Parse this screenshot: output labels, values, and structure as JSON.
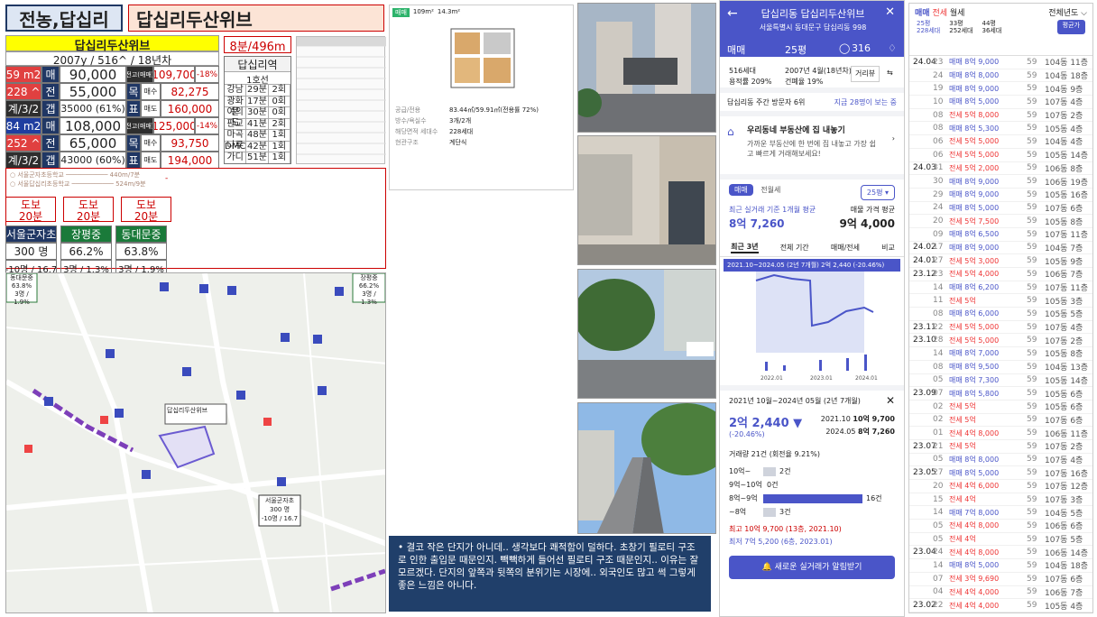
{
  "title": {
    "area": "전농,답십리",
    "complex": "답십리두산위브"
  },
  "summary": {
    "name": "답십리두산위브",
    "sub": "2007y / 516^ / 18년차",
    "walk": "8분/496m"
  },
  "rows": [
    {
      "size": "59 m2",
      "g1": "매",
      "v1": "90,000",
      "lbl": "전고(매매)",
      "hi": "109,700",
      "pct": "-18%",
      "bg": "red"
    },
    {
      "size": "228 ^",
      "g1": "전",
      "v1": "55,000",
      "lbl": "목",
      "sub": "매수",
      "v2": "82,275",
      "bg": "red"
    },
    {
      "size": "계/3/2",
      "g1": "갭",
      "v1": "35000 (61%)",
      "lbl": "표",
      "sub": "매도",
      "v2": "160,000",
      "bg": "dk"
    },
    {
      "size": "84 m2",
      "g1": "매",
      "v1": "108,000",
      "lbl": "전고(매매)",
      "hi": "125,000",
      "pct": "-14%",
      "bg": "blue"
    },
    {
      "size": "252 ^",
      "g1": "전",
      "v1": "65,000",
      "lbl": "목",
      "sub": "매수",
      "v2": "93,750",
      "bg": "red"
    },
    {
      "size": "계/3/2",
      "g1": "갭",
      "v1": "43000 (60%)",
      "lbl": "표",
      "sub": "매도",
      "v2": "194,000",
      "bg": "dk"
    }
  ],
  "station": {
    "name": "답십리역",
    "line": "1호선",
    "rows": [
      [
        "강남",
        "29분",
        "2회"
      ],
      [
        "광화문",
        "17분",
        "0회"
      ],
      [
        "여의도",
        "30분",
        "0회"
      ],
      [
        "판교",
        "41분",
        "2회"
      ],
      [
        "마곡나루",
        "48분",
        "1회"
      ],
      [
        "DMC",
        "42분",
        "1회"
      ],
      [
        "가디",
        "51분",
        "1회"
      ]
    ]
  },
  "schools": {
    "walks": [
      "도보\n20분",
      "도보\n20분",
      "도보\n20분"
    ],
    "names": [
      "서울군자초",
      "장평중",
      "동대문중"
    ],
    "stats": [
      "300 명",
      "66.2%",
      "63.8%"
    ],
    "sub": [
      "-10명 / 16.7",
      "3명 / 1.3%",
      "3명 / 1.9%"
    ]
  },
  "comment": "결코 작은 단지가 아니데.. 생각보다 쾌적함이 덜하다. 초창기 필로티 구조로 인한 출입문 때문인지. 빽빽하게 들어선 필로티 구조 때문인지.. 이유는 잘 모르겠다. 단지의 앞쪽과 뒷쪽의 분위기는 시장에.. 외국인도 많고 썩 그렇게 좋은 느낌은 아니다.",
  "app": {
    "title": "답십리동 답십리두산위브",
    "addr": "서울특별시 동대문구 답십리동 998",
    "tab": "매매",
    "size": "25평",
    "count": "316",
    "info1": "516세대",
    "info2": "2007년 4월(18년차)",
    "info3": "용적률 209%",
    "info4": "건폐율 19%",
    "visitor": "답십리동 주간 방문자 6위",
    "visitorLink": "지금 28명이 보는 중",
    "promoTitle": "우리동네 부동산에 집 내놓기",
    "promoBody": "가까운 부동산에 한 번에 집 내놓고 가장 쉽고 빠르게 거래해보세요!",
    "t1": "매매",
    "t2": "전월세",
    "sizeSel": "25평",
    "avgLbl": "최근 실거래 기준 1개월 평균",
    "avgVal": "8억 7,260",
    "askLbl": "매물 가격 평균",
    "askVal": "9억 4,000",
    "tabs": [
      "최근 3년",
      "전체 기간",
      "매매/전세",
      "비교"
    ],
    "range": "2021.10~2024.05 (2년 7개월)  2억 2,440 (-20.46%)",
    "period": "2021년 10월~2024년 05월 (2년 7개월)",
    "diff": "2억 2,440 ▼",
    "diffPct": "(-20.46%)",
    "hiDate": "2021.10",
    "hiVal": "10억 9,700",
    "loDate": "2024.05",
    "loVal": "8억 7,260",
    "tradeCnt": "거래량 21건 (회전율 9.21%)",
    "bins": [
      [
        "10억~",
        "2건"
      ],
      [
        "9억~10억",
        "0건"
      ],
      [
        "8억~9억",
        "16건"
      ],
      [
        "~8억",
        "3건"
      ]
    ],
    "best": "최고 10억 9,700 (13층, 2021.10)",
    "worst": "최저 7억 5,200 (6층, 2023.01)",
    "alert": "새로운 실거래가 알림받기"
  },
  "list": {
    "tabs": [
      "매매",
      "전세",
      "월세"
    ],
    "filter": "전체년도",
    "h1": "25평",
    "h2": "228세대",
    "h3": "33평",
    "h4": "252세대",
    "h5": "44평",
    "h6": "36세대",
    "btn": "평균가",
    "rows": [
      [
        "24.04",
        "23",
        "매매 8억 9,000",
        "59",
        "104동 11층"
      ],
      [
        "",
        "24",
        "매매 8억 8,000",
        "59",
        "104동 18층"
      ],
      [
        "",
        "19",
        "매매 8억 9,000",
        "59",
        "104동 9층"
      ],
      [
        "",
        "10",
        "매매 8억 5,000",
        "59",
        "107동 4층"
      ],
      [
        "",
        "08",
        "전세 5억 8,000",
        "59",
        "107동 2층"
      ],
      [
        "",
        "08",
        "매매 8억 5,300",
        "59",
        "105동 4층"
      ],
      [
        "",
        "06",
        "전세 5억 5,000",
        "59",
        "104동 4층"
      ],
      [
        "",
        "06",
        "전세 5억 5,000",
        "59",
        "105동 14층"
      ],
      [
        "24.03",
        "31",
        "전세 5억 2,000",
        "59",
        "106동 8층"
      ],
      [
        "",
        "30",
        "매매 8억 9,000",
        "59",
        "106동 19층"
      ],
      [
        "",
        "29",
        "매매 8억 9,000",
        "59",
        "105동 16층"
      ],
      [
        "",
        "24",
        "매매 8억 5,000",
        "59",
        "107동 6층"
      ],
      [
        "",
        "20",
        "전세 5억 7,500",
        "59",
        "105동 8층"
      ],
      [
        "",
        "09",
        "매매 8억 6,500",
        "59",
        "107동 11층"
      ],
      [
        "24.02",
        "17",
        "매매 8억 9,000",
        "59",
        "104동 7층"
      ],
      [
        "24.01",
        "27",
        "전세 5억 3,000",
        "59",
        "105동 9층"
      ],
      [
        "23.12",
        "23",
        "전세 5억 4,000",
        "59",
        "106동 7층"
      ],
      [
        "",
        "14",
        "매매 8억 6,200",
        "59",
        "107동 11층"
      ],
      [
        "",
        "11",
        "전세 5억",
        "59",
        "105동 3층"
      ],
      [
        "",
        "08",
        "매매 8억 6,000",
        "59",
        "105동 5층"
      ],
      [
        "23.11",
        "22",
        "전세 5억 5,000",
        "59",
        "107동 4층"
      ],
      [
        "23.10",
        "28",
        "전세 5억 5,000",
        "59",
        "107동 2층"
      ],
      [
        "",
        "14",
        "매매 8억 7,000",
        "59",
        "105동 8층"
      ],
      [
        "",
        "08",
        "매매 8억 9,500",
        "59",
        "104동 13층"
      ],
      [
        "",
        "05",
        "매매 8억 7,300",
        "59",
        "105동 14층"
      ],
      [
        "23.09",
        "07",
        "매매 8억 5,800",
        "59",
        "105동 6층"
      ],
      [
        "",
        "02",
        "전세 5억",
        "59",
        "105동 6층"
      ],
      [
        "",
        "02",
        "전세 5억",
        "59",
        "107동 6층"
      ],
      [
        "",
        "01",
        "전세 4억 8,000",
        "59",
        "106동 11층"
      ],
      [
        "23.07",
        "21",
        "전세 5억",
        "59",
        "107동 2층"
      ],
      [
        "",
        "05",
        "매매 8억 8,000",
        "59",
        "107동 4층"
      ],
      [
        "23.05",
        "27",
        "매매 8억 5,000",
        "59",
        "107동 16층"
      ],
      [
        "",
        "20",
        "전세 4억 6,000",
        "59",
        "107동 12층"
      ],
      [
        "",
        "15",
        "전세 4억",
        "59",
        "107동 3층"
      ],
      [
        "",
        "14",
        "매매 7억 8,000",
        "59",
        "104동 5층"
      ],
      [
        "",
        "05",
        "전세 4억 8,000",
        "59",
        "106동 6층"
      ],
      [
        "",
        "05",
        "전세 4억",
        "59",
        "107동 5층"
      ],
      [
        "23.04",
        "24",
        "전세 4억 8,000",
        "59",
        "106동 14층"
      ],
      [
        "",
        "14",
        "매매 8억 5,000",
        "59",
        "104동 18층"
      ],
      [
        "",
        "07",
        "전세 3억 9,690",
        "59",
        "107동 6층"
      ],
      [
        "",
        "04",
        "전세 4억 4,000",
        "59",
        "106동 7층"
      ],
      [
        "23.02",
        "22",
        "전세 4억 4,000",
        "59",
        "105동 4층"
      ]
    ]
  },
  "detail": {
    "head": [
      "공급/전용",
      "방수/욕실수",
      "해당면적 세대수",
      "현관구조"
    ],
    "vals": [
      "83.44㎡/59.91㎡(전용률 72%)",
      "3개/2개",
      "228세대",
      "계단식"
    ],
    "tag": "매매",
    "tag2": "109m²",
    "tag3": "14.3m²"
  }
}
